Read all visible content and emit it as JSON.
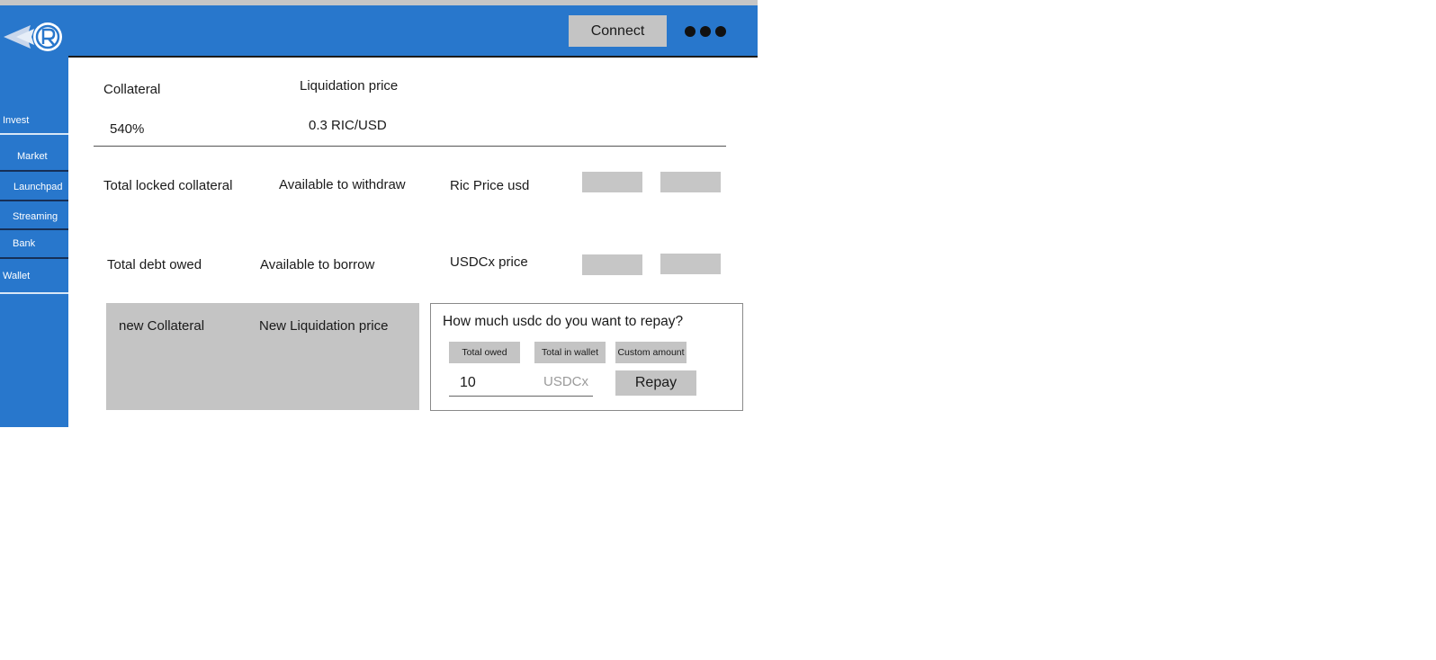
{
  "header": {
    "connect_label": "Connect",
    "logo_icon": "ricochet-logo-icon",
    "more_icon": "more-dots-icon"
  },
  "colors": {
    "brand_blue": "#2877cc",
    "placeholder_gray": "#c4c4c4"
  },
  "sidebar": {
    "items": [
      {
        "label": "Invest"
      },
      {
        "label": "Market"
      },
      {
        "label": "Launchpad"
      },
      {
        "label": "Streaming"
      },
      {
        "label": "Bank"
      },
      {
        "label": "Wallet"
      }
    ]
  },
  "summary": {
    "collateral_label": "Collateral",
    "collateral_value": "540%",
    "liquidation_label": "Liquidation price",
    "liquidation_value": "0.3 RIC/USD"
  },
  "stats": {
    "total_locked_label": "Total locked collateral",
    "available_withdraw_label": "Available to withdraw",
    "ric_price_label": "Ric Price usd",
    "total_debt_label": "Total debt owed",
    "available_borrow_label": "Available to borrow",
    "usdcx_price_label": "USDCx price"
  },
  "new_panel": {
    "new_collateral_label": "new Collateral",
    "new_liquidation_label": "New Liquidation price"
  },
  "repay": {
    "question": "How much usdc do you want to repay?",
    "total_owed_label": "Total owed",
    "total_wallet_label": "Total in wallet",
    "custom_amount_label": "Custom amount",
    "amount_value": "10",
    "unit": "USDCx",
    "repay_label": "Repay"
  }
}
